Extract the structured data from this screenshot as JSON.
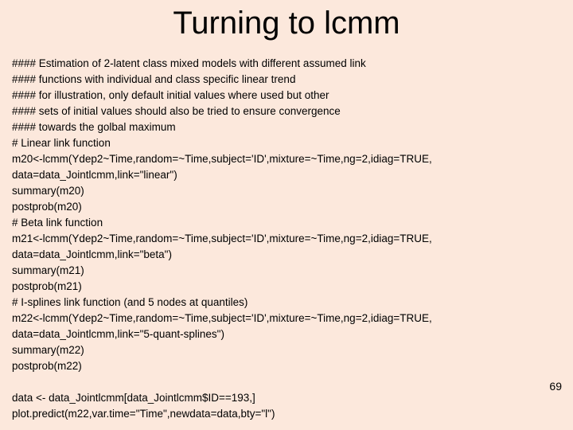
{
  "slide": {
    "title": "Turning to lcmm",
    "background_color": "#fce8dc",
    "text_color": "#000000",
    "page_number": "69",
    "code_lines": [
      "#### Estimation of 2-latent class mixed models with different assumed link",
      "#### functions with individual and class specific linear trend",
      "#### for illustration, only default initial values where used but other",
      "#### sets of initial values should also be tried to ensure convergence",
      "#### towards the golbal maximum",
      "# Linear link function",
      "m20<-lcmm(Ydep2~Time,random=~Time,subject='ID',mixture=~Time,ng=2,idiag=TRUE,",
      "data=data_Jointlcmm,link=\"linear\")",
      "summary(m20)",
      "postprob(m20)",
      "# Beta link function",
      "m21<-lcmm(Ydep2~Time,random=~Time,subject='ID',mixture=~Time,ng=2,idiag=TRUE,",
      "data=data_Jointlcmm,link=\"beta\")",
      "summary(m21)",
      "postprob(m21)",
      "# I-splines link function (and 5 nodes at quantiles)",
      "m22<-lcmm(Ydep2~Time,random=~Time,subject='ID',mixture=~Time,ng=2,idiag=TRUE,",
      "data=data_Jointlcmm,link=\"5-quant-splines\")",
      "summary(m22)",
      "postprob(m22)",
      "",
      "data <- data_Jointlcmm[data_Jointlcmm$ID==193,]",
      "plot.predict(m22,var.time=\"Time\",newdata=data,bty=\"l\")"
    ]
  }
}
